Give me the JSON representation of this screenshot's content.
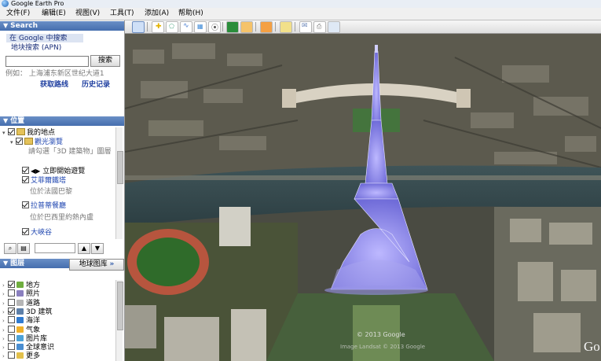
{
  "window": {
    "title": "Google Earth Pro"
  },
  "menu": [
    "文件(F)",
    "编辑(E)",
    "视图(V)",
    "工具(T)",
    "添加(A)",
    "帮助(H)"
  ],
  "search": {
    "header": "Search",
    "tab_google": "在 Google 中搜索",
    "tab_local": "地块搜索 (APN)",
    "input_value": "",
    "button": "搜索",
    "hint": "例如：  上海浦东新区世纪大道1",
    "get_directions": "获取路线",
    "history": "历史记录"
  },
  "places": {
    "header": "位置",
    "items": [
      {
        "label": "我的地点"
      },
      {
        "label": "觀光瀏覽"
      },
      {
        "label": "請勾選「3D 建築物」圖層"
      },
      {
        "label": "立即開始遊覽"
      },
      {
        "label": "艾菲爾鐵塔"
      },
      {
        "label": "位於法國巴黎"
      },
      {
        "label": "拉普蒂餐廳"
      },
      {
        "label": "位於巴西里約熱內盧"
      },
      {
        "label": "大峽谷"
      }
    ]
  },
  "layers": {
    "header": "图层",
    "gallery_button": "地球图库",
    "items": [
      {
        "label": "地方",
        "checked": true,
        "icon": "places-icon",
        "color": "#6fae3f"
      },
      {
        "label": "照片",
        "checked": false,
        "icon": "photos-icon",
        "color": "#8a7fbf"
      },
      {
        "label": "道路",
        "checked": false,
        "icon": "roads-icon",
        "color": "#b6b6b6"
      },
      {
        "label": "3D 建筑",
        "checked": true,
        "icon": "buildings-3d-icon",
        "color": "#5d7fa8"
      },
      {
        "label": "海洋",
        "checked": false,
        "icon": "ocean-icon",
        "color": "#2f7bd1"
      },
      {
        "label": "气象",
        "checked": false,
        "icon": "weather-icon",
        "color": "#f0b12a"
      },
      {
        "label": "图片库",
        "checked": false,
        "icon": "gallery-icon",
        "color": "#4da3d8"
      },
      {
        "label": "全球意识",
        "checked": false,
        "icon": "awareness-icon",
        "color": "#4a8ed1"
      },
      {
        "label": "更多",
        "checked": false,
        "icon": "more-icon",
        "color": "#e2c04b"
      }
    ]
  },
  "map": {
    "copyright": "© 2013 Google",
    "watermark": "Go",
    "geo_credit": "Image Landsat  © 2013 Google"
  },
  "colors": {
    "header_blue": "#456eae",
    "link_blue": "#1f46b0",
    "tower_glow": "#8a86ff"
  }
}
